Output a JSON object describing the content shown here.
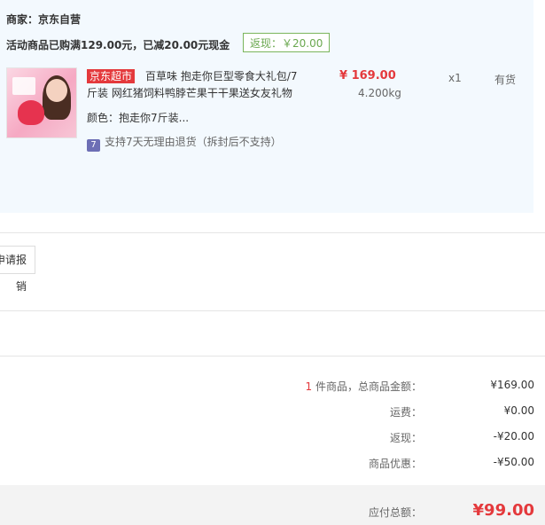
{
  "shop": {
    "merchant": "商家：京东自营",
    "promo": "活动商品已购满129.00元，已减20.00元现金",
    "rebate_tag": "返现：￥20.00"
  },
  "product": {
    "store_tag": "京东超市",
    "title_line1": "百草味 抱走你巨型零食大礼包/7",
    "title_line2": "斤装 网红猪饲料鸭脖芒果干干果送女友礼物",
    "price": "¥ 169.00",
    "weight": "4.200kg",
    "quantity": "x1",
    "stock": "有货",
    "color_label": "颜色：",
    "color_value": "抱走你7斤装...",
    "return_icon_text": "7",
    "return_policy": "支持7天无理由退货（拆封后不支持）"
  },
  "actions": {
    "reimburse_label": "申请报销"
  },
  "summary": {
    "count": "1",
    "count_suffix": " 件商品，总商品金额：",
    "total_goods": "¥169.00",
    "shipping_label": "运费：",
    "shipping_value": "¥0.00",
    "rebate_label": "返现：",
    "rebate_value": "-¥20.00",
    "discount_label": "商品优惠：",
    "discount_value": "-¥50.00",
    "pay_label": "应付总额：",
    "pay_value": "¥99.00"
  },
  "colors": {
    "accent_red": "#e4393c",
    "panel_bg": "#f3f9fe",
    "rebate_green": "#6aa84f"
  },
  "icons": [
    "product-thumbnail",
    "seven-day-return-icon"
  ]
}
